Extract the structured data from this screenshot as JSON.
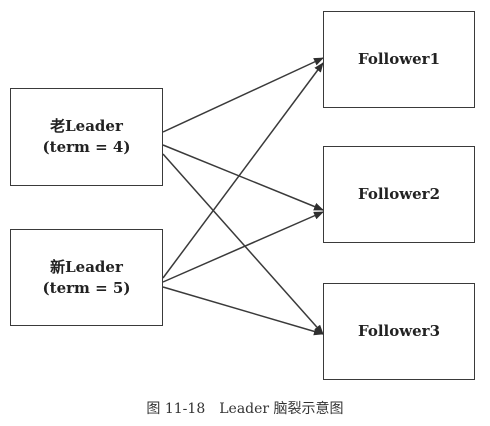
{
  "nodes": {
    "old_leader": {
      "line1": "老Leader",
      "line2": "(term = 4)"
    },
    "new_leader": {
      "line1": "新Leader",
      "line2": "(term = 5)"
    },
    "follower1": {
      "label": "Follower1"
    },
    "follower2": {
      "label": "Follower2"
    },
    "follower3": {
      "label": "Follower3"
    }
  },
  "edges": [
    {
      "from": "old_leader",
      "to": "follower1"
    },
    {
      "from": "old_leader",
      "to": "follower2"
    },
    {
      "from": "old_leader",
      "to": "follower3"
    },
    {
      "from": "new_leader",
      "to": "follower1"
    },
    {
      "from": "new_leader",
      "to": "follower2"
    },
    {
      "from": "new_leader",
      "to": "follower3"
    }
  ],
  "caption": {
    "number": "图 11-18",
    "text": "Leader 脑裂示意图"
  },
  "colors": {
    "line": "#3a3a3a",
    "text": "#222222"
  }
}
